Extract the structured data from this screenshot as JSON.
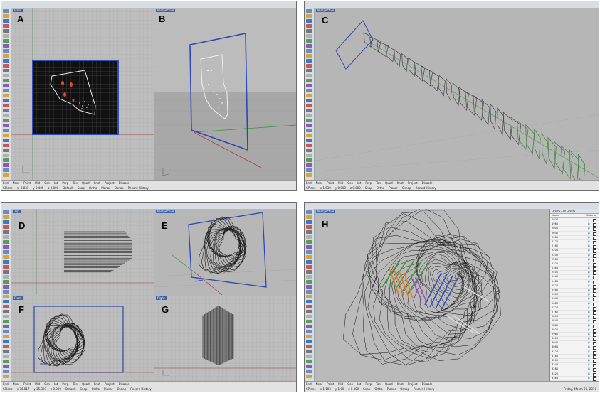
{
  "panels": [
    {
      "id": "win-top-left",
      "viewports": [
        {
          "tab": "Front",
          "letter": "A"
        },
        {
          "tab": "Perspective",
          "letter": "B"
        }
      ],
      "status_line1": [
        "End",
        "Near",
        "Point",
        "Mid",
        "Cen",
        "Int",
        "Perp",
        "Tan",
        "Quad",
        "Knot",
        "Project",
        "Disable"
      ],
      "status_line2": [
        "CPlane",
        "x -0.831",
        "y 0.405",
        "z 0.000",
        "Default",
        "Snap",
        "Ortho",
        "Planar",
        "Osnap",
        "Record History"
      ]
    },
    {
      "id": "win-top-right",
      "viewports": [
        {
          "tab": "Perspective",
          "letter": "C"
        }
      ],
      "status_line1": [
        "End",
        "Near",
        "Point",
        "Mid",
        "Cen",
        "Int",
        "Perp",
        "Tan",
        "Quad",
        "Knot",
        "Project",
        "Disable"
      ],
      "status_line2": [
        "CPlane",
        "x 1.530",
        "y 0.000",
        "z 0.000",
        "Snap",
        "Ortho",
        "Planar",
        "Osnap",
        "Record History"
      ]
    },
    {
      "id": "win-bottom-left",
      "viewports": [
        {
          "tab": "Top",
          "letter": "D"
        },
        {
          "tab": "Perspective",
          "letter": "E"
        },
        {
          "tab": "Front",
          "letter": "F"
        },
        {
          "tab": "Right",
          "letter": "G"
        }
      ],
      "status_line1": [
        "End",
        "Near",
        "Point",
        "Mid",
        "Cen",
        "Int",
        "Perp",
        "Tan",
        "Quad",
        "Knot",
        "Project",
        "Disable"
      ],
      "status_line2": [
        "CPlane",
        "x 76.817",
        "y 35.303",
        "z 0.000",
        "Default",
        "Snap",
        "Ortho",
        "Planar",
        "Osnap",
        "Record History"
      ]
    },
    {
      "id": "win-bottom-right",
      "viewports": [
        {
          "tab": "Perspective",
          "letter": "H"
        }
      ],
      "status_line1": [
        "End",
        "Near",
        "Point",
        "Mid",
        "Cen",
        "Int",
        "Perp",
        "Tan",
        "Quad",
        "Knot",
        "Project",
        "Disable"
      ],
      "status_line2": [
        "CPlane",
        "x 1.103",
        "y 1.00",
        "z 0.000",
        "Snap",
        "Ortho",
        "Planar",
        "Osnap",
        "Record History"
      ],
      "layers_title": "Layers - All Layers",
      "layers_header": [
        "Name",
        "Material"
      ],
      "layers": [
        "1920",
        "1960",
        "2000",
        "2040",
        "2080",
        "2120",
        "2160",
        "2200",
        "2240",
        "2280",
        "2320",
        "2360",
        "2400",
        "2440",
        "2480",
        "2520",
        "2560",
        "2600",
        "2640",
        "2680",
        "2720",
        "2760",
        "2800",
        "2840",
        "2880",
        "2920",
        "2960",
        "3000",
        "3040",
        "3080",
        "3120",
        "3160",
        "3200",
        "3240",
        "3280",
        "3320",
        "3360",
        "3400",
        "3440"
      ],
      "date_text": "Friday, March 26, 2010"
    }
  ]
}
